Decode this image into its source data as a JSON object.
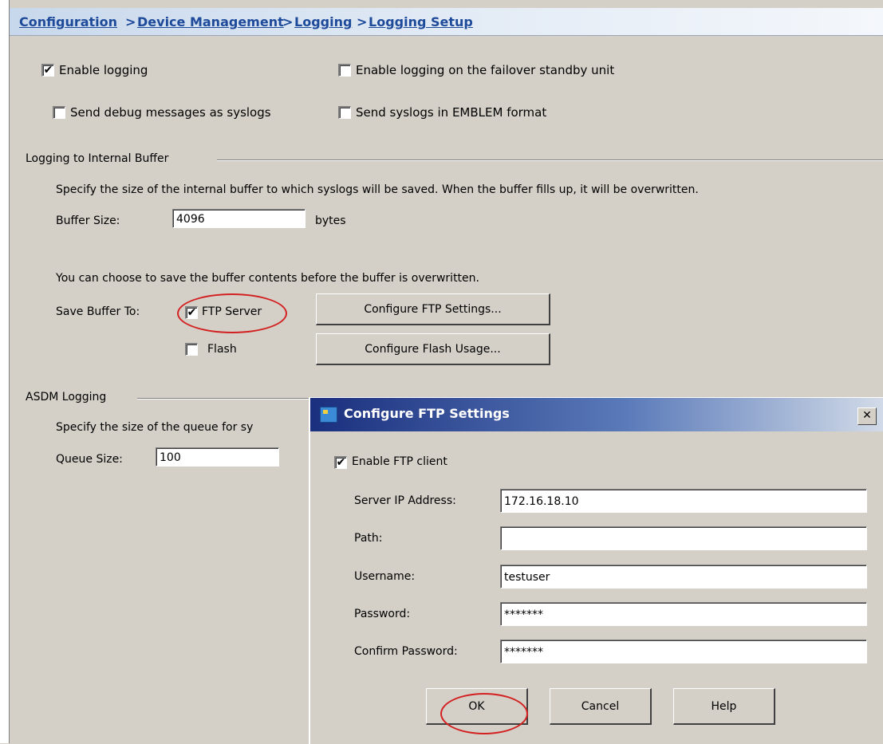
{
  "breadcrumb": {
    "items": [
      "Configuration",
      "Device Management",
      "Logging",
      "Logging Setup"
    ],
    "separator": ">"
  },
  "general": {
    "enable_logging": "Enable logging",
    "enable_logging_failover": "Enable logging on the failover standby unit",
    "send_debug": "Send debug messages as syslogs",
    "send_emblem": "Send syslogs in EMBLEM format"
  },
  "internal_buffer": {
    "title": "Logging to Internal Buffer",
    "description": "Specify the size of the internal buffer to which syslogs will be saved. When the buffer fills up, it will be overwritten.",
    "buffer_size_label": "Buffer Size:",
    "buffer_size_value": "4096",
    "buffer_unit": "bytes",
    "save_description": "You can choose to save the buffer contents before the buffer is overwritten.",
    "save_buffer_label": "Save Buffer To:",
    "ftp_server_label": "FTP Server",
    "flash_label": "Flash",
    "configure_ftp_button": "Configure FTP Settings...",
    "configure_flash_button": "Configure Flash Usage..."
  },
  "asdm_logging": {
    "title": "ASDM Logging",
    "description": "Specify the size of the queue for sy",
    "queue_size_label": "Queue Size:",
    "queue_size_value": "100"
  },
  "ftp_dialog": {
    "title": "Configure FTP Settings",
    "close_glyph": "✕",
    "enable_ftp_client": "Enable FTP client",
    "server_ip_label": "Server IP Address:",
    "server_ip_value": "172.16.18.10",
    "path_label": "Path:",
    "path_value": "",
    "username_label": "Username:",
    "username_value": "testuser",
    "password_label": "Password:",
    "password_value": "*******",
    "confirm_password_label": "Confirm Password:",
    "confirm_password_value": "*******",
    "ok_button": "OK",
    "cancel_button": "Cancel",
    "help_button": "Help"
  },
  "checkbox_glyph": "✔",
  "colors": {
    "breadcrumb_link": "#1e4a9a",
    "highlight_circle": "#d32020",
    "dialog_title_start": "#1a2f7e",
    "window_bg": "#d4d0c8"
  },
  "icons": {
    "dialog_title_icon": "ftp-settings-icon",
    "close_icon": "close-icon"
  }
}
